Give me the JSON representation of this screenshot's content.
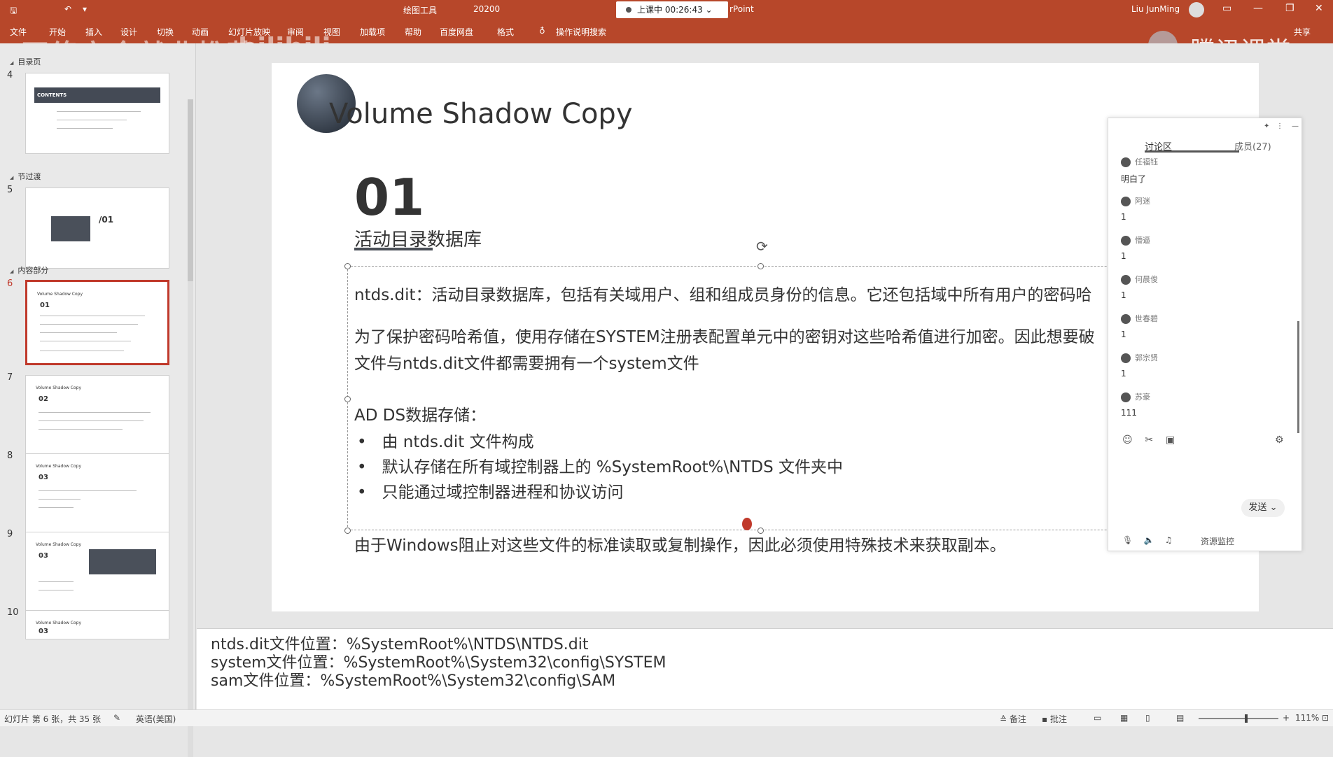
{
  "titlebar": {
    "save_icon": "save-icon",
    "customize_icon": "customize-quick-access-icon",
    "center_label": "绘图工具",
    "doc_name": "20200",
    "recording": "上课中 00:26:43",
    "app_suffix": "rPoint",
    "user": "Liu JunMing"
  },
  "ribbon": {
    "tabs": [
      "文件",
      "开始",
      "插入",
      "设计",
      "切换",
      "动画",
      "幻灯片放映",
      "审阅",
      "视图",
      "加载项",
      "帮助",
      "百度网盘",
      "格式",
      "操作说明搜索"
    ],
    "share": "共享"
  },
  "overlay": {
    "watermark_left": "网络安全就业推荐",
    "bili": "bilibili",
    "tencent": "腾讯课堂"
  },
  "thumbnails": {
    "sections": [
      "目录页",
      "节过渡",
      "内容部分"
    ],
    "slides": [
      {
        "num": "4",
        "title": "CONTENTS"
      },
      {
        "num": "5",
        "title": "/01"
      },
      {
        "num": "6",
        "title": "Volume Shadow Copy",
        "tag": "01"
      },
      {
        "num": "7",
        "title": "Volume Shadow Copy",
        "tag": "02"
      },
      {
        "num": "8",
        "title": "Volume Shadow Copy",
        "tag": "03"
      },
      {
        "num": "9",
        "title": "Volume Shadow Copy",
        "tag": "03"
      },
      {
        "num": "10",
        "title": "Volume Shadow Copy",
        "tag": "03"
      }
    ]
  },
  "slide": {
    "title": "Volume Shadow Copy",
    "number": "01",
    "subtitle": "活动目录数据库",
    "para1": "ntds.dit：活动目录数据库，包括有关域用户、组和组成员身份的信息。它还包括域中所有用户的密码哈",
    "para2a": "为了保护密码哈希值，使用存储在SYSTEM注册表配置单元中的密钥对这些哈希值进行加密。因此想要破",
    "para2b": "文件与ntds.dit文件都需要拥有一个system文件",
    "para3": "AD DS数据存储：",
    "bullets": [
      "由 ntds.dit 文件构成",
      "默认存储在所有域控制器上的 %SystemRoot%\\NTDS 文件夹中",
      "只能通过域控制器进程和协议访问"
    ],
    "para4": "由于Windows阻止对这些文件的标准读取或复制操作，因此必须使用特殊技术来获取副本。"
  },
  "chat": {
    "tab_discuss": "讨论区",
    "tab_members": "成员(27)",
    "messages": [
      {
        "user": "任福钰",
        "text": "明白了"
      },
      {
        "user": "阿迷",
        "text": "1"
      },
      {
        "user": "懵逼",
        "text": "1"
      },
      {
        "user": "何晨俊",
        "text": "1"
      },
      {
        "user": "世春碧",
        "text": "1"
      },
      {
        "user": "郭宗贤",
        "text": "1"
      },
      {
        "user": "苏豪",
        "text": "111"
      }
    ],
    "send": "发送",
    "resource": "资源监控"
  },
  "notes": {
    "lines": [
      "ntds.dit文件位置：%SystemRoot%\\NTDS\\NTDS.dit",
      "system文件位置：%SystemRoot%\\System32\\config\\SYSTEM",
      "sam文件位置：%SystemRoot%\\System32\\config\\SAM"
    ]
  },
  "status": {
    "slide_info": "幻灯片 第 6 张，共 35 张",
    "lang": "英语(美国)",
    "notes_btn": "备注",
    "comments_btn": "批注",
    "zoom": "111%"
  }
}
